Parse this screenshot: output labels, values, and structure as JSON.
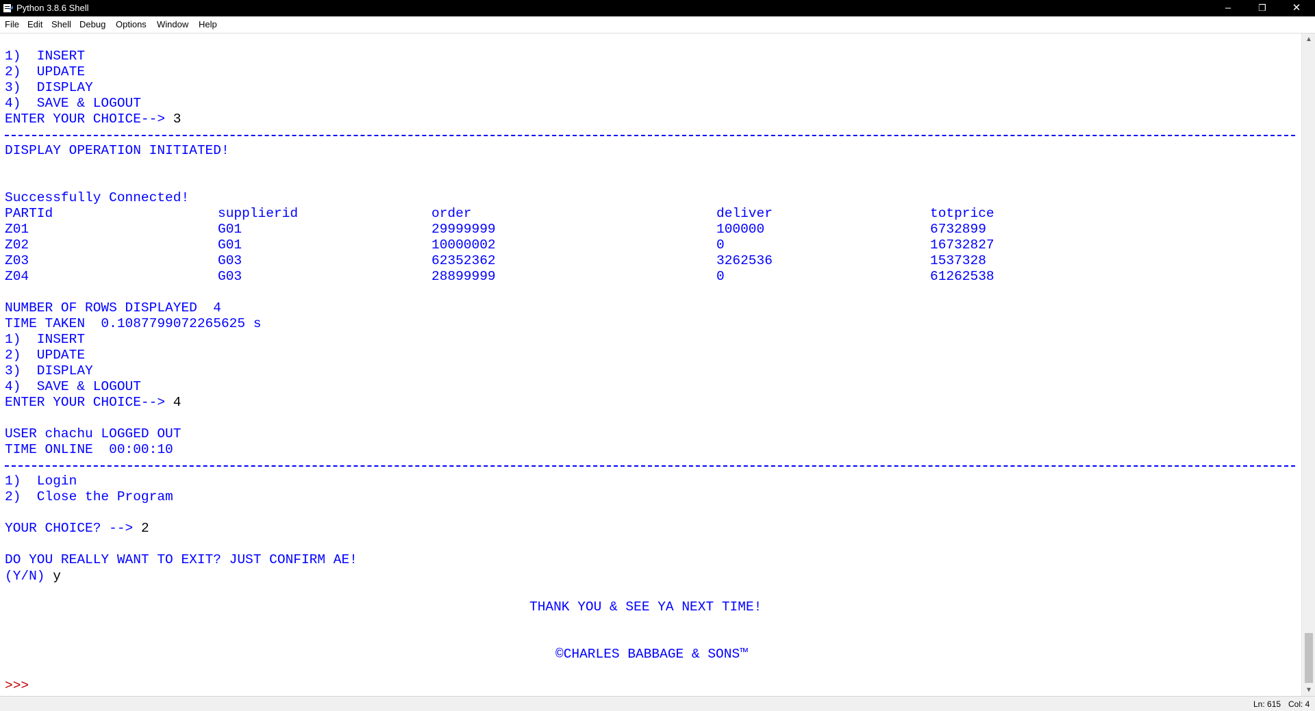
{
  "window": {
    "title": "Python 3.8.6 Shell",
    "controls": {
      "minimize": "–",
      "restore": "❐",
      "close": "✕"
    }
  },
  "menu": [
    "File",
    "Edit",
    "Shell",
    "Debug",
    "Options",
    "Window",
    "Help"
  ],
  "shell": {
    "menu1": {
      "opt1": "1)  INSERT",
      "opt2": "2)  UPDATE",
      "opt3": "3)  DISPLAY",
      "opt4": "4)  SAVE & LOGOUT",
      "choice_prompt": "ENTER YOUR CHOICE--> ",
      "choice_value": "3"
    },
    "display_initiated": "DISPLAY OPERATION INITIATED!",
    "connected": "Successfully Connected!",
    "table": {
      "headers": [
        "PARTId",
        "supplierid",
        "order",
        "deliver",
        "totprice"
      ],
      "rows": [
        [
          "Z01",
          "G01",
          "29999999",
          "100000",
          "6732899"
        ],
        [
          "Z02",
          "G01",
          "10000002",
          "0",
          "16732827"
        ],
        [
          "Z03",
          "G03",
          "62352362",
          "3262536",
          "1537328"
        ],
        [
          "Z04",
          "G03",
          "28899999",
          "0",
          "61262538"
        ]
      ]
    },
    "rows_displayed": "NUMBER OF ROWS DISPLAYED  4",
    "time_taken": "TIME TAKEN  0.1087799072265625 s",
    "menu2": {
      "opt1": "1)  INSERT",
      "opt2": "2)  UPDATE",
      "opt3": "3)  DISPLAY",
      "opt4": "4)  SAVE & LOGOUT",
      "choice_prompt": "ENTER YOUR CHOICE--> ",
      "choice_value": "4"
    },
    "logged_out": "USER chachu LOGGED OUT",
    "time_online": "TIME ONLINE  00:00:10",
    "login_menu": {
      "opt1": "1)  Login",
      "opt2": "2)  Close the Program"
    },
    "your_choice_prompt": "YOUR CHOICE? --> ",
    "your_choice_value": "2",
    "exit_confirm": "DO YOU REALLY WANT TO EXIT? JUST CONFIRM AE!",
    "yn_prompt": "(Y/N) ",
    "yn_value": "y",
    "thank_you": "THANK YOU & SEE YA NEXT TIME!",
    "copyright": "©CHARLES BABBAGE & SONS™",
    "repl_prompt": ">>>"
  },
  "status": {
    "line": "Ln: 615",
    "col": "Col: 4"
  },
  "colors": {
    "output_text": "#0000ff",
    "user_input": "#000000",
    "prompt": "#c00000",
    "titlebar": "#000000"
  }
}
